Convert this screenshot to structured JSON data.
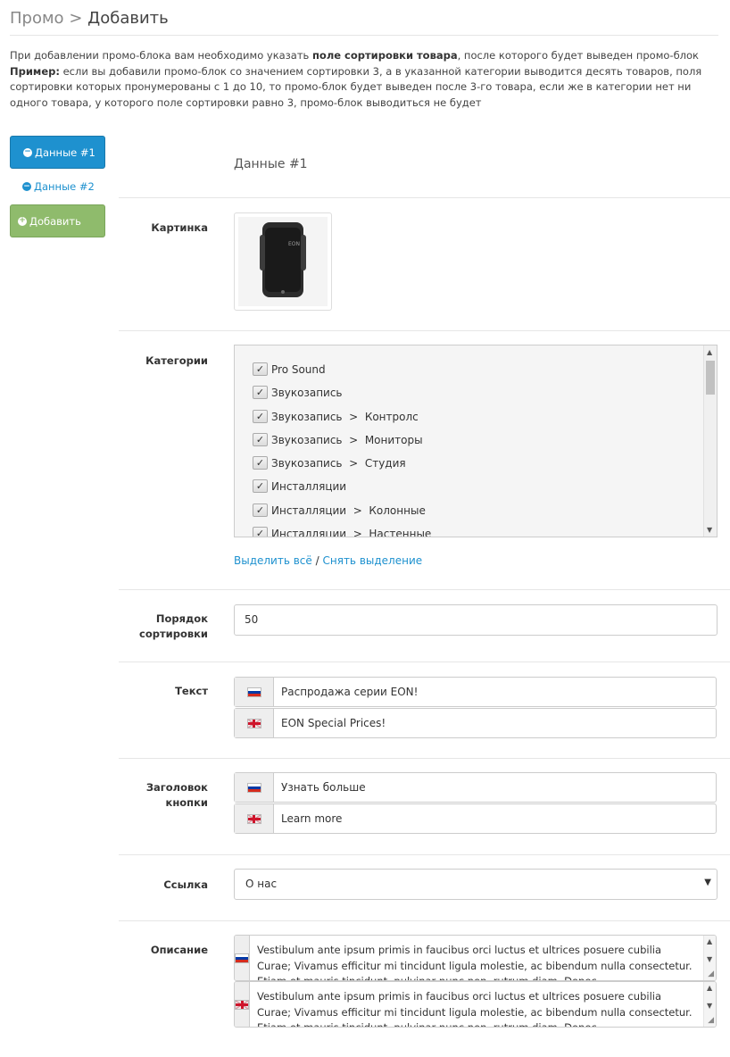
{
  "header": {
    "crumb": "Промо",
    "separator": ">",
    "title": "Добавить"
  },
  "intro": {
    "line1_pre": "При добавлении промо-блока вам необходимо указать ",
    "line1_bold": "поле сортировки товара",
    "line1_post": ", после которого будет выведен промо-блок",
    "example_label": "Пример:",
    "example_text": " если вы добавили промо-блок со значением сортировки 3, а в указанной категории выводится десять товаров, поля сортировки которых пронумерованы с 1 до 10, то промо-блок будет выведен после 3-го товара, если же в категории нет ни одного товара, у которого поле сортировки равно 3, промо-блок выводиться не будет"
  },
  "tabs": {
    "items": [
      {
        "label": "Данные #1",
        "icon": "minus-circle-icon",
        "active": true
      },
      {
        "label": "Данные #2",
        "icon": "minus-circle-icon",
        "active": false
      }
    ],
    "add_label": "Добавить",
    "add_icon": "plus-circle-icon"
  },
  "form": {
    "legend": "Данные #1",
    "image_label": "Картинка",
    "image_desc": "EON",
    "categories_label": "Категории",
    "categories": [
      {
        "label": "Pro Sound",
        "checked": true
      },
      {
        "label": "Звукозапись",
        "checked": true
      },
      {
        "label": "Звукозапись  >  Контролс",
        "checked": true
      },
      {
        "label": "Звукозапись  >  Мониторы",
        "checked": true
      },
      {
        "label": "Звукозапись  >  Студия",
        "checked": true
      },
      {
        "label": "Инсталляции",
        "checked": true
      },
      {
        "label": "Инсталляции  >  Колонные",
        "checked": true
      },
      {
        "label": "Инсталляции  >  Настенные",
        "checked": true
      }
    ],
    "select_all": "Выделить всё",
    "select_sep": "/",
    "deselect": "Снять выделение",
    "sort_label": "Порядок сортировки",
    "sort_value": "50",
    "text_label": "Текст",
    "text_ru": "Распродажа серии EON!",
    "text_en": "EON Special Prices!",
    "button_title_label": "Заголовок кнопки",
    "button_title_ru": "Узнать больше",
    "button_title_en": "Learn more",
    "link_label": "Ссылка",
    "link_value": "О нас",
    "description_label": "Описание",
    "description_ru": "Vestibulum ante ipsum primis in faucibus orci luctus et ultrices posuere cubilia Curae; Vivamus efficitur mi tincidunt ligula molestie, ac bibendum nulla consectetur. Etiam et mauris tincidunt, pulvinar nunc non, rutrum diam. Donec",
    "description_en": "Vestibulum ante ipsum primis in faucibus orci luctus et ultrices posuere cubilia Curae; Vivamus efficitur mi tincidunt ligula molestie, ac bibendum nulla consectetur. Etiam et mauris tincidunt, pulvinar nunc non, rutrum diam. Donec"
  },
  "colors": {
    "primary": "#1e91cf",
    "success": "#8fbb6c",
    "border": "#cccccc"
  }
}
